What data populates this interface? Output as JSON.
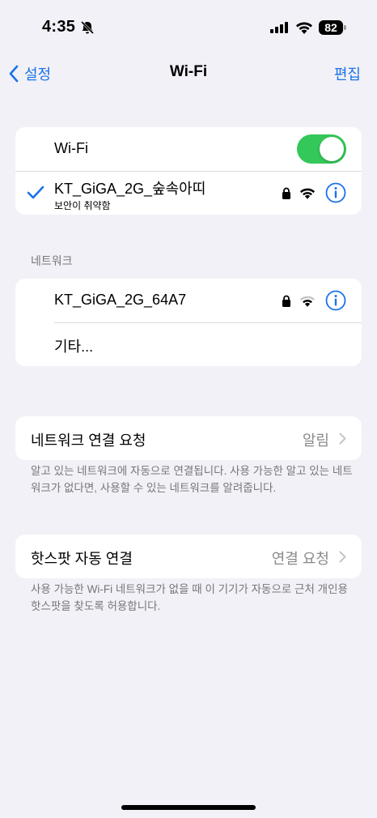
{
  "status": {
    "time": "4:35",
    "battery": "82"
  },
  "nav": {
    "back_label": "설정",
    "title": "Wi-Fi",
    "edit_label": "편집"
  },
  "wifi": {
    "toggle_label": "Wi-Fi",
    "toggle_on": true,
    "connected": {
      "name": "KT_GiGA_2G_숲속아띠",
      "security": "보안이 취약함"
    }
  },
  "networks": {
    "header": "네트워크",
    "items": [
      {
        "name": "KT_GiGA_2G_64A7"
      }
    ],
    "other_label": "기타..."
  },
  "ask_join": {
    "label": "네트워크 연결 요청",
    "value": "알림",
    "footer": "알고 있는 네트워크에 자동으로 연결됩니다. 사용 가능한 알고 있는 네트워크가 없다면, 사용할 수 있는 네트워크를 알려줍니다."
  },
  "hotspot": {
    "label": "핫스팟 자동 연결",
    "value": "연결 요청",
    "footer": "사용 가능한 Wi-Fi 네트워크가 없을 때 이 기기가 자동으로 근처 개인용 핫스팟을 찾도록 허용합니다."
  },
  "colors": {
    "accent": "#1a73e8",
    "toggle_on": "#34c759",
    "background": "#f2f1f7"
  }
}
